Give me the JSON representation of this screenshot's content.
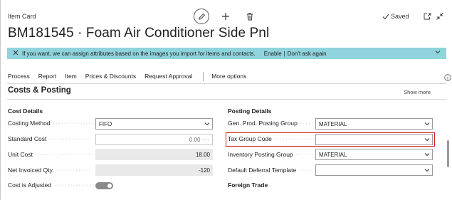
{
  "header": {
    "page_type": "Item Card",
    "saved_label": "Saved",
    "title": "BM181545 · Foam Air Conditioner Side Pnl"
  },
  "notification": {
    "message": "If you want, we can assign attributes based on the images you import for items and contacts.",
    "enable_label": "Enable",
    "separator": "|",
    "dismiss_label": "Don't ask again"
  },
  "actions": {
    "items": [
      "Process",
      "Report",
      "Item",
      "Prices & Discounts",
      "Request Approval"
    ],
    "more_options": "More options"
  },
  "section": {
    "title": "Costs & Posting",
    "show_more": "Show more"
  },
  "cost_details": {
    "title": "Cost Details",
    "costing_method": {
      "label": "Costing Method",
      "value": "FIFO"
    },
    "standard_cost": {
      "label": "Standard Cost",
      "value": "0.00"
    },
    "unit_cost": {
      "label": "Unit Cost",
      "value": "18.00"
    },
    "net_invoiced_qty": {
      "label": "Net Invoiced Qty.",
      "value": "-120"
    },
    "cost_is_adjusted": {
      "label": "Cost is Adjusted",
      "value": true
    }
  },
  "posting_details": {
    "title": "Posting Details",
    "gen_prod_posting_group": {
      "label": "Gen. Prod. Posting Group",
      "value": "MATERIAL"
    },
    "tax_group_code": {
      "label": "Tax Group Code",
      "value": ""
    },
    "inventory_posting_group": {
      "label": "Inventory Posting Group",
      "value": "MATERIAL"
    },
    "default_deferral_template": {
      "label": "Default Deferral Template",
      "value": ""
    }
  },
  "foreign_trade": {
    "title": "Foreign Trade"
  },
  "colors": {
    "notification_bg": "#8fd3dc",
    "highlight_border": "#d32020",
    "readonly_bg": "#e9e9e9"
  },
  "icons": [
    "edit-icon",
    "add-icon",
    "delete-icon",
    "check-icon",
    "open-new-window-icon",
    "collapse-icon",
    "close-icon",
    "chevron-down-icon",
    "info-icon"
  ]
}
